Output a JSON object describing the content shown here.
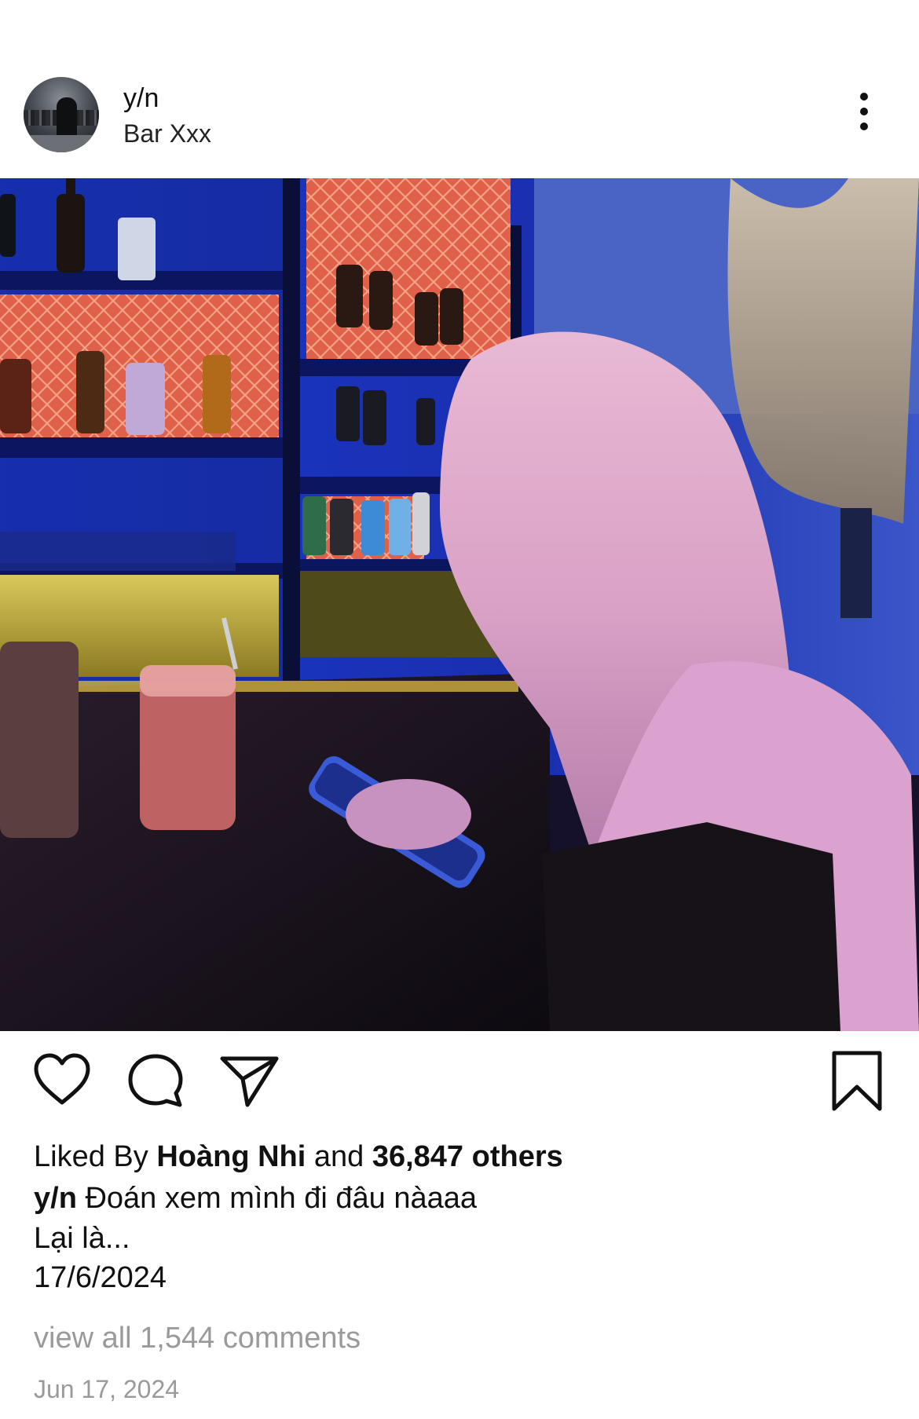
{
  "post": {
    "username": "y/n",
    "location": "Bar Xxx",
    "likes_prefix": "Liked By ",
    "liked_by": "Hoàng Nhi",
    "likes_middle": " and ",
    "likes_count": "36,847 others",
    "caption_user": "y/n",
    "caption_text": " Đoán xem mình đi đâu nàaaa",
    "caption_line2": "Lại là...",
    "caption_line3": "17/6/2024",
    "view_comments": "view all 1,544 comments",
    "date": "Jun 17, 2024"
  },
  "icons": {
    "more": "more-options-icon",
    "like": "heart-icon",
    "comment": "comment-bubble-icon",
    "share": "paper-plane-icon",
    "save": "bookmark-icon"
  },
  "colors": {
    "text": "#111111",
    "muted": "#9a9a9a",
    "background": "#ffffff"
  }
}
